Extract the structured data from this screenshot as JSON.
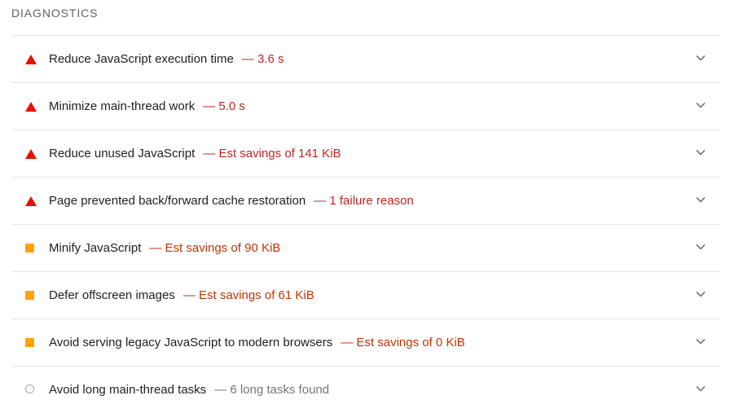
{
  "section": {
    "title": "DIAGNOSTICS"
  },
  "audits": [
    {
      "title": "Reduce JavaScript execution time",
      "display": "— 3.6 s",
      "status": "fail",
      "icon": "triangle-fail-icon",
      "color": "#eb0f00"
    },
    {
      "title": "Minimize main-thread work",
      "display": "— 5.0 s",
      "status": "fail",
      "icon": "triangle-fail-icon",
      "color": "#eb0f00"
    },
    {
      "title": "Reduce unused JavaScript",
      "display": "— Est savings of 141 KiB",
      "status": "fail",
      "icon": "triangle-fail-icon",
      "color": "#eb0f00"
    },
    {
      "title": "Page prevented back/forward cache restoration",
      "display": "— 1 failure reason",
      "status": "fail",
      "icon": "triangle-fail-icon",
      "color": "#eb0f00"
    },
    {
      "title": "Minify JavaScript",
      "display": "— Est savings of 90 KiB",
      "status": "average",
      "icon": "square-average-icon",
      "color": "#ffa400"
    },
    {
      "title": "Defer offscreen images",
      "display": "— Est savings of 61 KiB",
      "status": "average",
      "icon": "square-average-icon",
      "color": "#ffa400"
    },
    {
      "title": "Avoid serving legacy JavaScript to modern browsers",
      "display": "— Est savings of 0 KiB",
      "status": "average",
      "icon": "square-average-icon",
      "color": "#ffa400"
    },
    {
      "title": "Avoid long main-thread tasks",
      "display": "— 6 long tasks found",
      "status": "info",
      "icon": "circle-info-icon",
      "color": "#a6a6a6"
    }
  ]
}
